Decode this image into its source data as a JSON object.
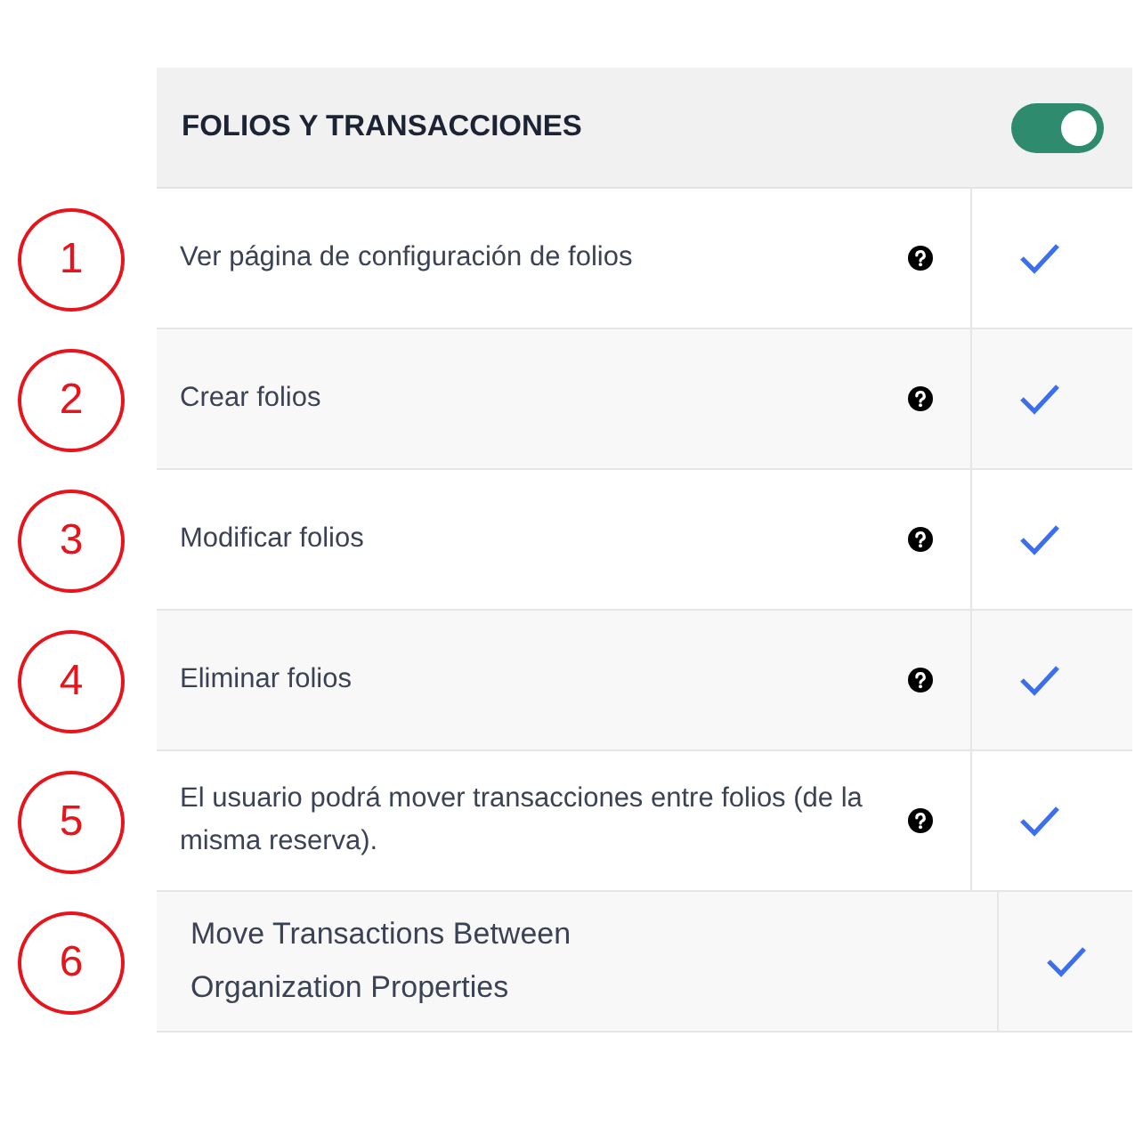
{
  "section": {
    "title": "FOLIOS Y TRANSACCIONES",
    "on": true
  },
  "rows": [
    {
      "marker": "1",
      "label": "Ver página de configuración de folios",
      "help": true,
      "checked": true
    },
    {
      "marker": "2",
      "label": "Crear folios",
      "help": true,
      "checked": true
    },
    {
      "marker": "3",
      "label": "Modificar folios",
      "help": true,
      "checked": true
    },
    {
      "marker": "4",
      "label": "Eliminar folios",
      "help": true,
      "checked": true
    },
    {
      "marker": "5",
      "label": "El usuario podrá mover transacciones entre folios (de la misma reserva).",
      "help": true,
      "checked": true
    },
    {
      "marker": "6",
      "label": "Move Transactions Between Organization Properties",
      "help": false,
      "checked": true
    }
  ]
}
